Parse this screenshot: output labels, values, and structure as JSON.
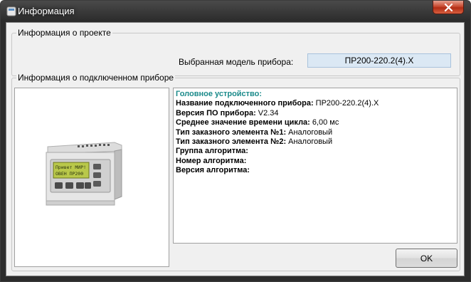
{
  "window": {
    "title": "Информация"
  },
  "project_group": {
    "label": "Информация о проекте",
    "model_label": "Выбранная модель прибора:",
    "model_value": "ПР200-220.2(4).Х"
  },
  "device_group": {
    "label": "Информация о подключенном приборе",
    "device_screen_line1": "Привет МИР!",
    "device_screen_line2": "ОВЕН ПР200",
    "info": {
      "heading": "Головное устройство:",
      "rows": [
        {
          "key": "Название подключенного прибора:",
          "value": "ПР200-220.2(4).Х"
        },
        {
          "key": "Версия ПО прибора:",
          "value": "V2.34"
        },
        {
          "key": "Среднее значение времени цикла:",
          "value": "6,00 мс"
        },
        {
          "key": "Тип заказного элемента №1:",
          "value": "Аналоговый"
        },
        {
          "key": "Тип заказного элемента №2:",
          "value": "Аналоговый"
        },
        {
          "key": "Группа алгоритма:",
          "value": ""
        },
        {
          "key": "Номер алгоритма:",
          "value": ""
        },
        {
          "key": "Версия алгоритма:",
          "value": ""
        }
      ]
    }
  },
  "buttons": {
    "ok_label": "OK"
  },
  "colors": {
    "heading": "#1a8a8a",
    "model_field_bg": "#dbe8f4",
    "close_button": "#c84a30"
  }
}
